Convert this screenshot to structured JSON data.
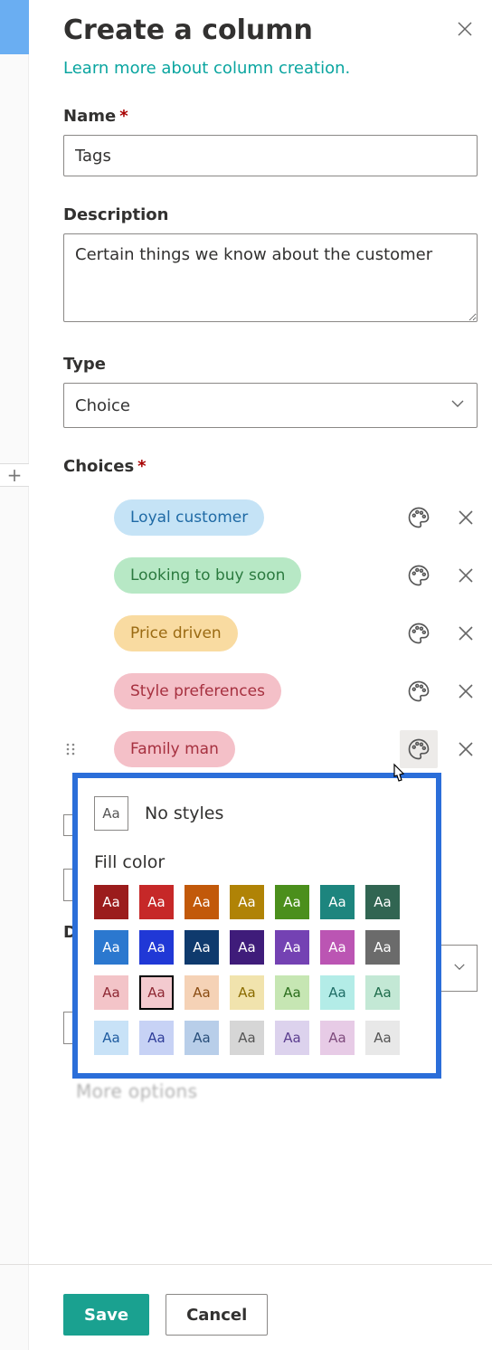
{
  "heading": "Create a column",
  "learn_link": "Learn more about column creation.",
  "labels": {
    "name": "Name",
    "description": "Description",
    "type": "Type",
    "choices": "Choices"
  },
  "name_field": {
    "value": "Tags",
    "placeholder": ""
  },
  "description_field": {
    "value": "Certain things we know about the customer"
  },
  "type_field": {
    "value": "Choice"
  },
  "choices": [
    {
      "label": "Loyal customer",
      "bg": "#c5e3f6",
      "fg": "#1f6aa5"
    },
    {
      "label": "Looking to buy soon",
      "bg": "#b7e8c5",
      "fg": "#2b7a3f"
    },
    {
      "label": "Price driven",
      "bg": "#f9dba1",
      "fg": "#9a6a12"
    },
    {
      "label": "Style preferences",
      "bg": "#f4c0c8",
      "fg": "#a6303f"
    },
    {
      "label": "Family man",
      "bg": "#f4c0c8",
      "fg": "#a6303f"
    }
  ],
  "color_popup": {
    "no_styles_label": "No styles",
    "fill_color_label": "Fill color",
    "swatch_text": "Aa",
    "selected_index": 15,
    "swatches": [
      {
        "bg": "#9b1c1c",
        "fg": "#ffffff"
      },
      {
        "bg": "#c62828",
        "fg": "#ffffff"
      },
      {
        "bg": "#c2590a",
        "fg": "#ffffff"
      },
      {
        "bg": "#b08306",
        "fg": "#ffffff"
      },
      {
        "bg": "#4b8f1c",
        "fg": "#ffffff"
      },
      {
        "bg": "#1d857e",
        "fg": "#ffffff"
      },
      {
        "bg": "#316552",
        "fg": "#ffffff"
      },
      {
        "bg": "#2b78cf",
        "fg": "#ffffff"
      },
      {
        "bg": "#2038d6",
        "fg": "#ffffff"
      },
      {
        "bg": "#0f3a6d",
        "fg": "#ffffff"
      },
      {
        "bg": "#3f1c7a",
        "fg": "#ffffff"
      },
      {
        "bg": "#7442b3",
        "fg": "#ffffff"
      },
      {
        "bg": "#bb55b3",
        "fg": "#ffffff"
      },
      {
        "bg": "#6b6b6b",
        "fg": "#ffffff"
      },
      {
        "bg": "#f3c4c8",
        "fg": "#8e2833"
      },
      {
        "bg": "#f3cacf",
        "fg": "#8e2833"
      },
      {
        "bg": "#f5d2b6",
        "fg": "#8a4c12"
      },
      {
        "bg": "#f1e3ad",
        "fg": "#8a6b00"
      },
      {
        "bg": "#c6e6b3",
        "fg": "#2b6e1d"
      },
      {
        "bg": "#b3ece7",
        "fg": "#1f6d66"
      },
      {
        "bg": "#c3e8d5",
        "fg": "#1f6d4c"
      },
      {
        "bg": "#c8e2f7",
        "fg": "#1f5ca0"
      },
      {
        "bg": "#c7d2f5",
        "fg": "#2f3d99"
      },
      {
        "bg": "#b8cee9",
        "fg": "#294f7a"
      },
      {
        "bg": "#d6d6d6",
        "fg": "#555555"
      },
      {
        "bg": "#dcd2ed",
        "fg": "#5b3e8f"
      },
      {
        "bg": "#e7cbe6",
        "fg": "#7e4a7c"
      },
      {
        "bg": "#e8e8e8",
        "fg": "#555555"
      }
    ]
  },
  "more_options_text": "More options",
  "footer": {
    "save": "Save",
    "cancel": "Cancel"
  }
}
